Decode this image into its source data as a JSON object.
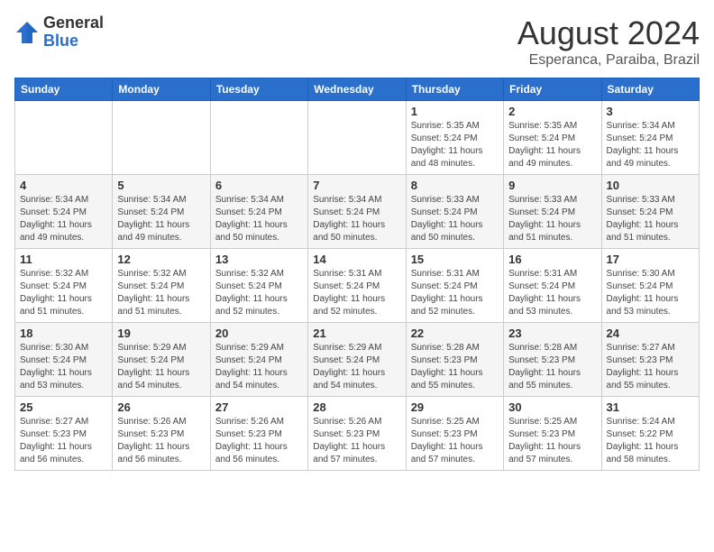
{
  "header": {
    "logo_line1": "General",
    "logo_line2": "Blue",
    "month_title": "August 2024",
    "location": "Esperanca, Paraiba, Brazil"
  },
  "days_of_week": [
    "Sunday",
    "Monday",
    "Tuesday",
    "Wednesday",
    "Thursday",
    "Friday",
    "Saturday"
  ],
  "weeks": [
    [
      {
        "day": "",
        "info": ""
      },
      {
        "day": "",
        "info": ""
      },
      {
        "day": "",
        "info": ""
      },
      {
        "day": "",
        "info": ""
      },
      {
        "day": "1",
        "info": "Sunrise: 5:35 AM\nSunset: 5:24 PM\nDaylight: 11 hours and 48 minutes."
      },
      {
        "day": "2",
        "info": "Sunrise: 5:35 AM\nSunset: 5:24 PM\nDaylight: 11 hours and 49 minutes."
      },
      {
        "day": "3",
        "info": "Sunrise: 5:34 AM\nSunset: 5:24 PM\nDaylight: 11 hours and 49 minutes."
      }
    ],
    [
      {
        "day": "4",
        "info": "Sunrise: 5:34 AM\nSunset: 5:24 PM\nDaylight: 11 hours and 49 minutes."
      },
      {
        "day": "5",
        "info": "Sunrise: 5:34 AM\nSunset: 5:24 PM\nDaylight: 11 hours and 49 minutes."
      },
      {
        "day": "6",
        "info": "Sunrise: 5:34 AM\nSunset: 5:24 PM\nDaylight: 11 hours and 50 minutes."
      },
      {
        "day": "7",
        "info": "Sunrise: 5:34 AM\nSunset: 5:24 PM\nDaylight: 11 hours and 50 minutes."
      },
      {
        "day": "8",
        "info": "Sunrise: 5:33 AM\nSunset: 5:24 PM\nDaylight: 11 hours and 50 minutes."
      },
      {
        "day": "9",
        "info": "Sunrise: 5:33 AM\nSunset: 5:24 PM\nDaylight: 11 hours and 51 minutes."
      },
      {
        "day": "10",
        "info": "Sunrise: 5:33 AM\nSunset: 5:24 PM\nDaylight: 11 hours and 51 minutes."
      }
    ],
    [
      {
        "day": "11",
        "info": "Sunrise: 5:32 AM\nSunset: 5:24 PM\nDaylight: 11 hours and 51 minutes."
      },
      {
        "day": "12",
        "info": "Sunrise: 5:32 AM\nSunset: 5:24 PM\nDaylight: 11 hours and 51 minutes."
      },
      {
        "day": "13",
        "info": "Sunrise: 5:32 AM\nSunset: 5:24 PM\nDaylight: 11 hours and 52 minutes."
      },
      {
        "day": "14",
        "info": "Sunrise: 5:31 AM\nSunset: 5:24 PM\nDaylight: 11 hours and 52 minutes."
      },
      {
        "day": "15",
        "info": "Sunrise: 5:31 AM\nSunset: 5:24 PM\nDaylight: 11 hours and 52 minutes."
      },
      {
        "day": "16",
        "info": "Sunrise: 5:31 AM\nSunset: 5:24 PM\nDaylight: 11 hours and 53 minutes."
      },
      {
        "day": "17",
        "info": "Sunrise: 5:30 AM\nSunset: 5:24 PM\nDaylight: 11 hours and 53 minutes."
      }
    ],
    [
      {
        "day": "18",
        "info": "Sunrise: 5:30 AM\nSunset: 5:24 PM\nDaylight: 11 hours and 53 minutes."
      },
      {
        "day": "19",
        "info": "Sunrise: 5:29 AM\nSunset: 5:24 PM\nDaylight: 11 hours and 54 minutes."
      },
      {
        "day": "20",
        "info": "Sunrise: 5:29 AM\nSunset: 5:24 PM\nDaylight: 11 hours and 54 minutes."
      },
      {
        "day": "21",
        "info": "Sunrise: 5:29 AM\nSunset: 5:24 PM\nDaylight: 11 hours and 54 minutes."
      },
      {
        "day": "22",
        "info": "Sunrise: 5:28 AM\nSunset: 5:23 PM\nDaylight: 11 hours and 55 minutes."
      },
      {
        "day": "23",
        "info": "Sunrise: 5:28 AM\nSunset: 5:23 PM\nDaylight: 11 hours and 55 minutes."
      },
      {
        "day": "24",
        "info": "Sunrise: 5:27 AM\nSunset: 5:23 PM\nDaylight: 11 hours and 55 minutes."
      }
    ],
    [
      {
        "day": "25",
        "info": "Sunrise: 5:27 AM\nSunset: 5:23 PM\nDaylight: 11 hours and 56 minutes."
      },
      {
        "day": "26",
        "info": "Sunrise: 5:26 AM\nSunset: 5:23 PM\nDaylight: 11 hours and 56 minutes."
      },
      {
        "day": "27",
        "info": "Sunrise: 5:26 AM\nSunset: 5:23 PM\nDaylight: 11 hours and 56 minutes."
      },
      {
        "day": "28",
        "info": "Sunrise: 5:26 AM\nSunset: 5:23 PM\nDaylight: 11 hours and 57 minutes."
      },
      {
        "day": "29",
        "info": "Sunrise: 5:25 AM\nSunset: 5:23 PM\nDaylight: 11 hours and 57 minutes."
      },
      {
        "day": "30",
        "info": "Sunrise: 5:25 AM\nSunset: 5:23 PM\nDaylight: 11 hours and 57 minutes."
      },
      {
        "day": "31",
        "info": "Sunrise: 5:24 AM\nSunset: 5:22 PM\nDaylight: 11 hours and 58 minutes."
      }
    ]
  ]
}
